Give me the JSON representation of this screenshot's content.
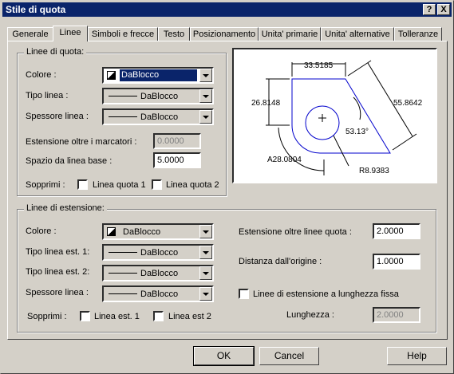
{
  "window": {
    "title": "Stile di quota",
    "help_btn": "?",
    "close_btn": "X"
  },
  "tabs": [
    {
      "label": "Generale"
    },
    {
      "label": "Linee"
    },
    {
      "label": "Simboli e frecce"
    },
    {
      "label": "Testo"
    },
    {
      "label": "Posizionamento"
    },
    {
      "label": "Unita' primarie"
    },
    {
      "label": "Unita' alternative"
    },
    {
      "label": "Tolleranze"
    }
  ],
  "dim_lines": {
    "title": "Linee di quota:",
    "color_label": "Colore :",
    "color_value": "DaBlocco",
    "linetype_label": "Tipo linea :",
    "linetype_value": "DaBlocco",
    "lineweight_label": "Spessore linea :",
    "lineweight_value": "DaBlocco",
    "extend_ticks_label": "Estensione oltre i marcatori :",
    "extend_ticks_value": "0.0000",
    "baseline_spacing_label": "Spazio da linea base :",
    "baseline_spacing_value": "5.0000",
    "suppress_label": "Sopprimi :",
    "suppress_1": "Linea quota 1",
    "suppress_2": "Linea quota 2"
  },
  "preview": {
    "dim_top": "33.5185",
    "dim_left": "26.8148",
    "dim_right": "55.8642",
    "angle": "53.13°",
    "arc": "A28.0804",
    "radius": "R8.9383"
  },
  "ext_lines": {
    "title": "Linee di estensione:",
    "color_label": "Colore :",
    "color_value": "DaBlocco",
    "linetype1_label": "Tipo linea est. 1:",
    "linetype1_value": "DaBlocco",
    "linetype2_label": "Tipo linea est. 2:",
    "linetype2_value": "DaBlocco",
    "lineweight_label": "Spessore linea :",
    "lineweight_value": "DaBlocco",
    "suppress_label": "Sopprimi :",
    "suppress_1": "Linea est. 1",
    "suppress_2": "Linea est 2",
    "extend_beyond_label": "Estensione oltre linee quota :",
    "extend_beyond_value": "2.0000",
    "offset_label": "Distanza dall'origine :",
    "offset_value": "1.0000",
    "fixed_length_label": "Linee di estensione a lunghezza fissa",
    "length_label": "Lunghezza :",
    "length_value": "2.0000"
  },
  "buttons": {
    "ok": "OK",
    "cancel": "Cancel",
    "help": "Help"
  }
}
